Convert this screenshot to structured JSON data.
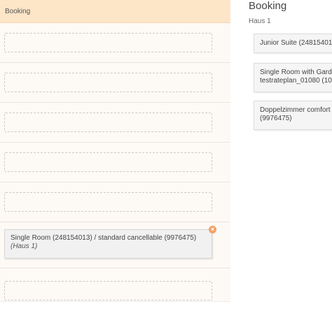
{
  "left_panel": {
    "header": "Booking",
    "empty_slot_count": 5,
    "booked_item": {
      "title": "Single Room (248154013) / standard cancellable (9976475)",
      "location": "(Haus 1)"
    },
    "remove_icon": "close-icon"
  },
  "right_panel": {
    "title": "Booking",
    "subtitle": "Haus 1",
    "rooms": [
      {
        "line1": "Junior Suite (24815401",
        "line2": ""
      },
      {
        "line1": "Single Room with Gard",
        "line2": "testrateplan_01080 (10"
      },
      {
        "line1": "Doppelzimmer comfort",
        "line2": "(9976475)"
      }
    ]
  },
  "colors": {
    "header_bg": "#fde5c8",
    "panel_bg": "#fdf9f5",
    "accent": "#f0a16a"
  }
}
